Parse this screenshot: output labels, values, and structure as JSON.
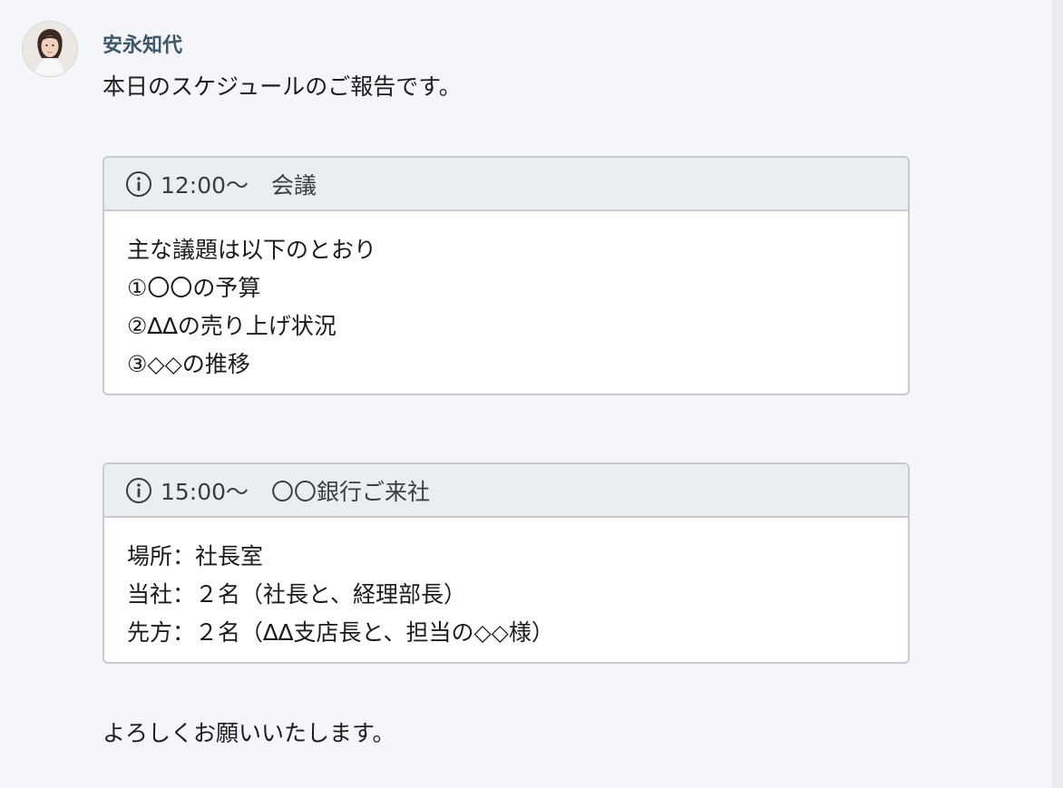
{
  "message": {
    "sender": "安永知代",
    "intro": "本日のスケジュールのご報告です。",
    "closing": "よろしくお願いいたします。"
  },
  "blocks": [
    {
      "icon": "info-icon",
      "title": "12:00〜　会議",
      "lines": [
        "主な議題は以下のとおり",
        "①〇〇の予算",
        "②∆∆の売り上げ状況",
        "③◇◇の推移"
      ]
    },
    {
      "icon": "info-icon",
      "title": "15:00〜　〇〇銀行ご来社",
      "lines": [
        "場所：社長室",
        "当社：２名（社長と、経理部長）",
        "先方：２名（∆∆支店長と、担当の◇◇様）"
      ]
    }
  ],
  "colors": {
    "background": "#f5f6fa",
    "sender": "#3c5868",
    "box_header": "#e9eef2",
    "box_border": "#c7cbd0"
  }
}
